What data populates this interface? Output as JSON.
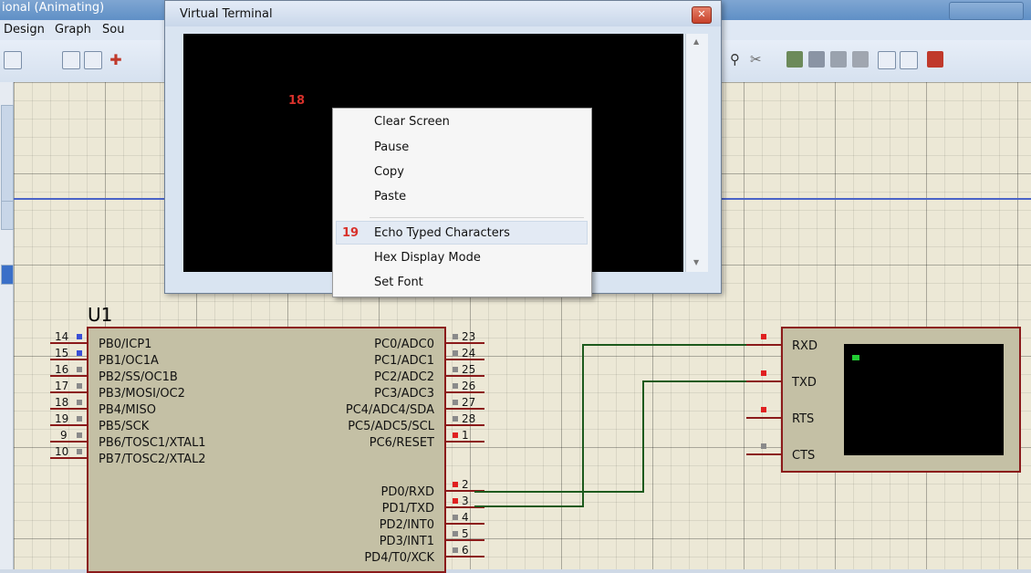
{
  "main_window": {
    "title": "ional (Animating)",
    "menu": [
      "Design",
      "Graph",
      "Sou"
    ]
  },
  "virtual_terminal": {
    "title": "Virtual Terminal",
    "close_glyph": "✕",
    "annotation": "18"
  },
  "context_menu": {
    "items": [
      "Clear Screen",
      "Pause",
      "Copy",
      "Paste",
      "Echo Typed Characters",
      "Hex Display Mode",
      "Set Font"
    ],
    "highlight_annotation": "19"
  },
  "chip": {
    "label": "U1",
    "left_pins": [
      {
        "num": "14",
        "name": "PB0/ICP1"
      },
      {
        "num": "15",
        "name": "PB1/OC1A"
      },
      {
        "num": "16",
        "name": "PB2/SS/OC1B"
      },
      {
        "num": "17",
        "name": "PB3/MOSI/OC2"
      },
      {
        "num": "18",
        "name": "PB4/MISO"
      },
      {
        "num": "19",
        "name": "PB5/SCK"
      },
      {
        "num": "9",
        "name": "PB6/TOSC1/XTAL1"
      },
      {
        "num": "10",
        "name": "PB7/TOSC2/XTAL2"
      }
    ],
    "right_pins": [
      {
        "num": "23",
        "name": "PC0/ADC0"
      },
      {
        "num": "24",
        "name": "PC1/ADC1"
      },
      {
        "num": "25",
        "name": "PC2/ADC2"
      },
      {
        "num": "26",
        "name": "PC3/ADC3"
      },
      {
        "num": "27",
        "name": "PC4/ADC4/SDA"
      },
      {
        "num": "28",
        "name": "PC5/ADC5/SCL"
      },
      {
        "num": "1",
        "name": "PC6/RESET"
      },
      {
        "num": "2",
        "name": "PD0/RXD"
      },
      {
        "num": "3",
        "name": "PD1/TXD"
      },
      {
        "num": "4",
        "name": "PD2/INT0"
      },
      {
        "num": "5",
        "name": "PD3/INT1"
      },
      {
        "num": "6",
        "name": "PD4/T0/XCK"
      }
    ]
  },
  "terminal_component": {
    "pins": [
      "RXD",
      "TXD",
      "RTS",
      "CTS"
    ]
  },
  "colors": {
    "pin_blue": "#3a4fd6",
    "pin_red": "#e02020",
    "pin_gray": "#8a8a8a",
    "wire": "#1d5a1d",
    "annotation": "#d8312b"
  }
}
